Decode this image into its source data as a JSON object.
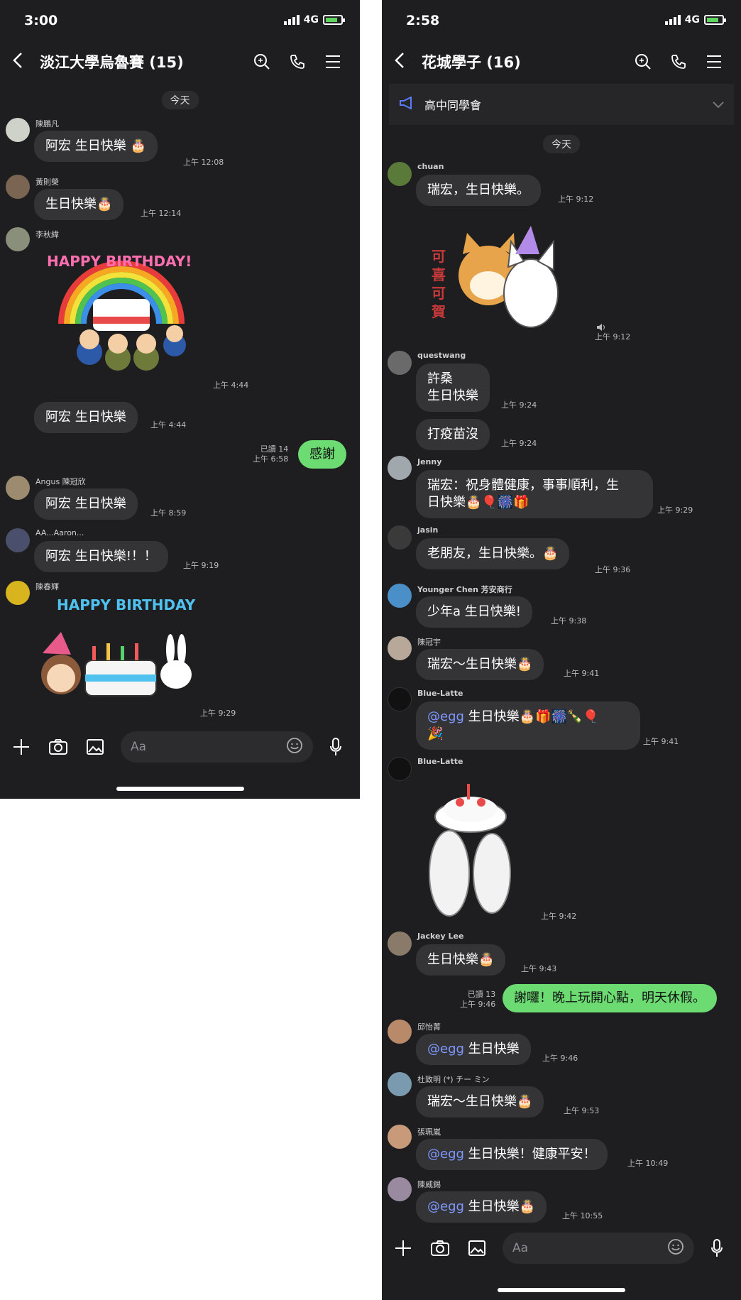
{
  "left": {
    "status_time": "3:00",
    "network": "4G",
    "title": "淡江大學烏魯賽 (15)",
    "day": "今天",
    "messages": [
      {
        "sender": "陳鵬凡",
        "text": "阿宏  生日快樂 🎂",
        "time": "上午 12:08"
      },
      {
        "sender": "黃則榮",
        "text": "生日快樂🎂",
        "time": "上午 12:14"
      },
      {
        "sender": "李秋緯",
        "sticker_text": "HAPPY BIRTHDAY!",
        "time": "上午 4:44"
      },
      {
        "text": "阿宏 生日快樂",
        "time": "上午 4:44"
      },
      {
        "sender": "Angus 陳冠欣",
        "text": "阿宏 生日快樂",
        "time": "上午 8:59"
      },
      {
        "sender": "AA...Aaron...",
        "text": "阿宏 生日快樂!！！",
        "time": "上午 9:19"
      },
      {
        "sender": "陳春輝",
        "sticker_text": "HAPPY BIRTHDAY",
        "time": "上午 9:29"
      }
    ],
    "outgoing": {
      "text": "感謝",
      "read": "已讀 14",
      "time": "上午 6:58"
    },
    "input_placeholder": "Aa"
  },
  "right": {
    "status_time": "2:58",
    "network": "4G",
    "title": "花城學子 (16)",
    "announcement": "高中同學會",
    "day": "今天",
    "messages": [
      {
        "sender": "chuan",
        "text": "瑞宏，生日快樂。",
        "time": "上午 9:12"
      },
      {
        "sticker_text": "可喜可賀",
        "time": "上午 9:12"
      },
      {
        "sender": "questwang",
        "text1": "許桑",
        "text2": "生日快樂",
        "time": "上午 9:24"
      },
      {
        "text": "打疫苗沒",
        "time": "上午 9:24"
      },
      {
        "sender": "Jenny",
        "text1": "瑞宏：祝身體健康，事事順利，生",
        "text2": "日快樂🎂🎈🎆🎁",
        "time": "上午 9:29"
      },
      {
        "sender": "jasin",
        "text": "老朋友，生日快樂。🎂",
        "time": "上午 9:36"
      },
      {
        "sender": "Younger Chen  芳安商行",
        "text": "少年a  生日快樂!",
        "time": "上午 9:38"
      },
      {
        "sender": "陳冠宇",
        "text": "瑞宏～生日快樂🎂",
        "time": "上午 9:41"
      },
      {
        "sender": "Blue-Latte",
        "mention": "@egg",
        "text": " 生日快樂🎂🎁🎆🍾🎈",
        "text2": "🎉",
        "time": "上午 9:41"
      },
      {
        "sender": "Blue-Latte",
        "time": "上午 9:42"
      },
      {
        "sender": "Jackey Lee",
        "text": "生日快樂🎂",
        "time": "上午 9:43"
      },
      {
        "sender": "邱怡菁",
        "mention": "@egg",
        "text": " 生日快樂",
        "time": "上午 9:46"
      },
      {
        "sender": "杜致明 (*) チー ミン",
        "text": "瑞宏～生日快樂🎂",
        "time": "上午 9:53"
      },
      {
        "sender": "張珮嵐",
        "mention": "@egg",
        "text": " 生日快樂！健康平安！",
        "time": "上午 10:49"
      },
      {
        "sender": "陳威錫",
        "mention": "@egg",
        "text": " 生日快樂🎂",
        "time": "上午 10:55"
      }
    ],
    "outgoing": {
      "text": "謝囉！晚上玩開心點，明天休假。",
      "read": "已讀 13",
      "time": "上午 9:46"
    },
    "input_placeholder": "Aa"
  },
  "colors": {
    "background": "#1e1e20",
    "bubble": "#343436",
    "outgoing": "#6bdb72",
    "mention": "#7e98ff"
  }
}
